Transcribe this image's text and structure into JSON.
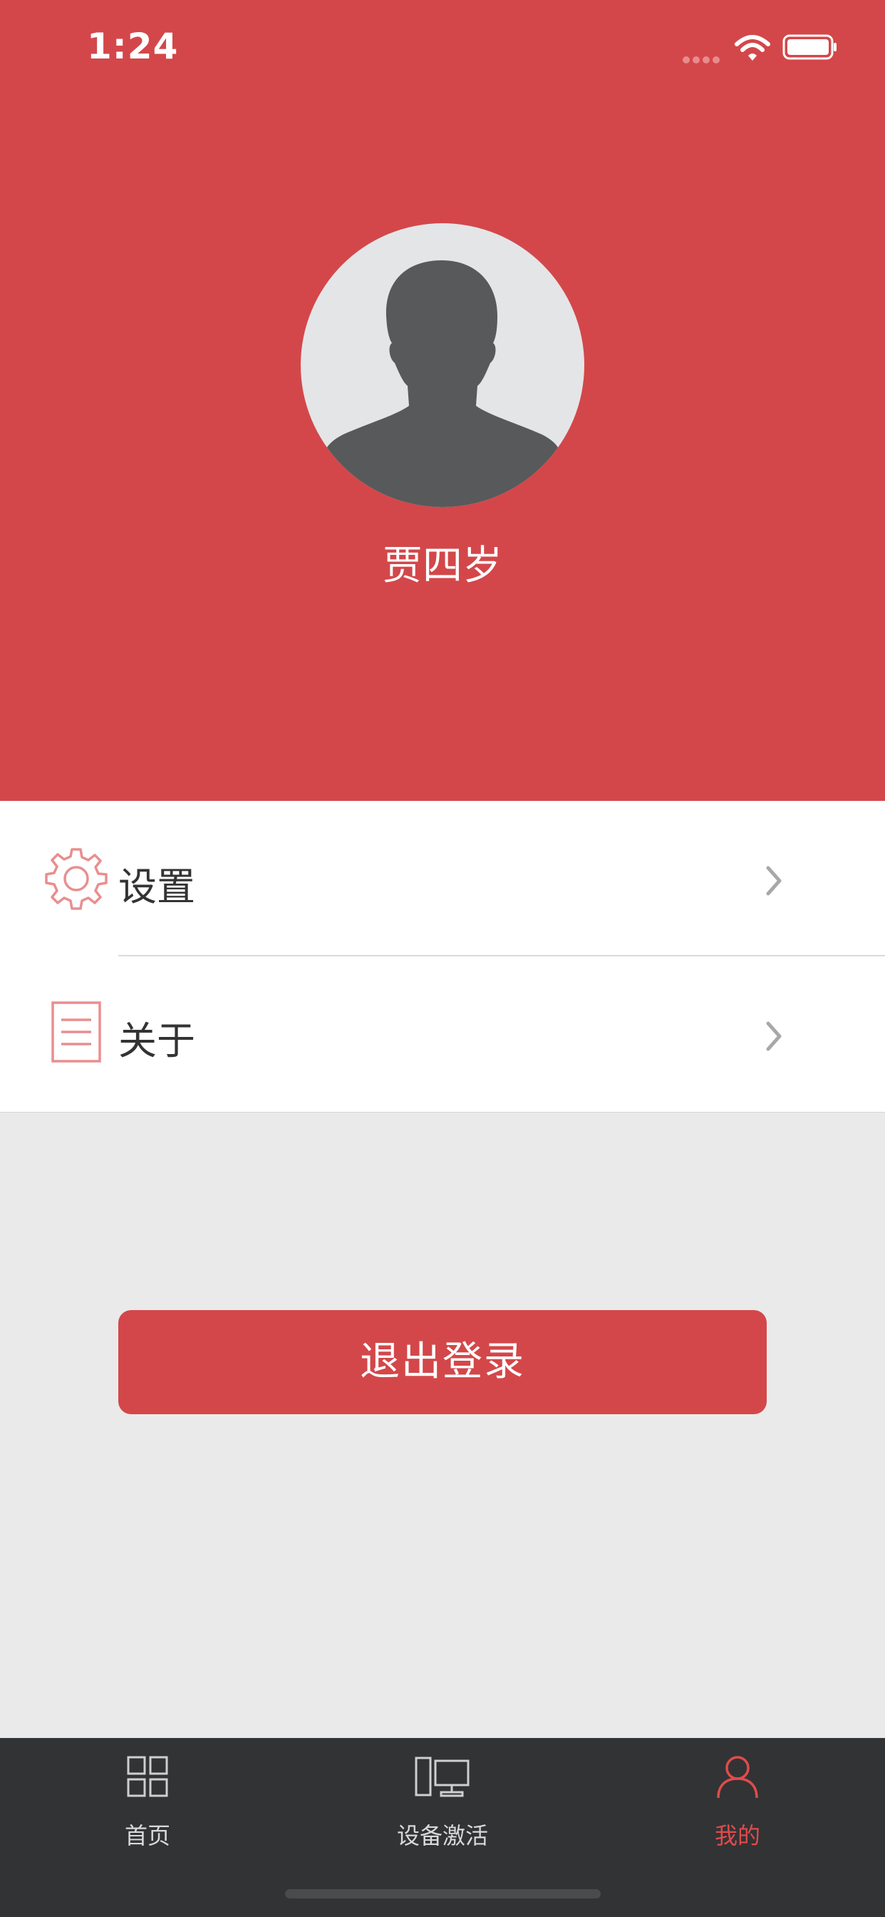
{
  "status_bar": {
    "time": "1:24"
  },
  "profile": {
    "name": "贾四岁"
  },
  "menu": {
    "items": [
      {
        "label": "设置",
        "icon": "gear-icon"
      },
      {
        "label": "关于",
        "icon": "document-icon"
      }
    ]
  },
  "logout": {
    "label": "退出登录"
  },
  "tab_bar": {
    "tabs": [
      {
        "label": "首页",
        "icon": "grid-icon",
        "active": false
      },
      {
        "label": "设备激活",
        "icon": "device-icon",
        "active": false
      },
      {
        "label": "我的",
        "icon": "user-icon",
        "active": true
      }
    ]
  },
  "colors": {
    "brand": "#d3474a",
    "background": "#eaeaea",
    "tab_bar": "#323335",
    "tab_active": "#e14b4b"
  }
}
